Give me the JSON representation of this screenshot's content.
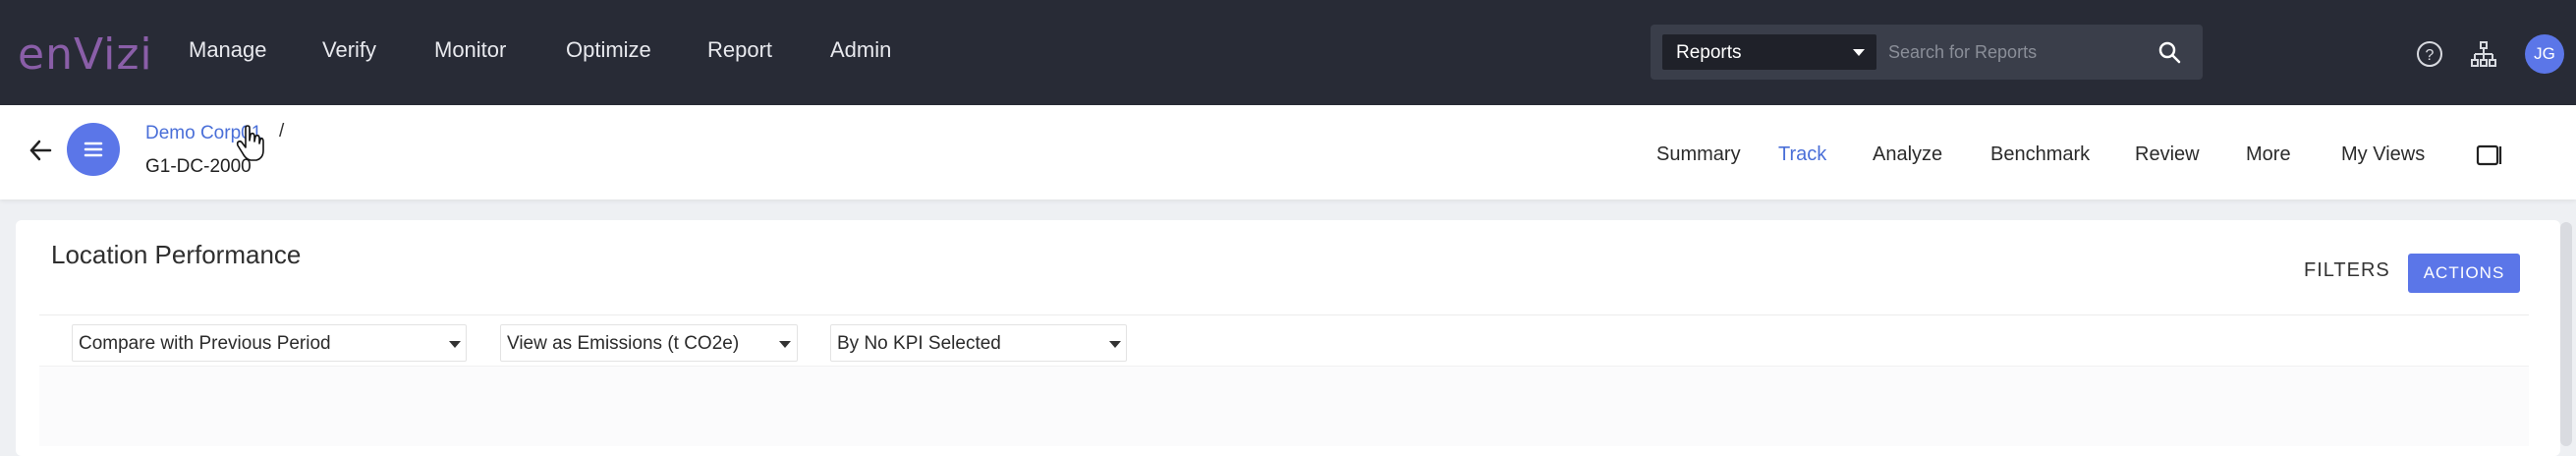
{
  "topnav": {
    "logo": "enVizi",
    "items": [
      "Manage",
      "Verify",
      "Monitor",
      "Optimize",
      "Report",
      "Admin"
    ],
    "search_scope": "Reports",
    "search_placeholder": "Search for Reports",
    "user_initials": "JG"
  },
  "breadcrumb": {
    "parent": "Demo Corp01",
    "separator": "/",
    "current": "G1-DC-2000"
  },
  "tabs": [
    "Summary",
    "Track",
    "Analyze",
    "Benchmark",
    "Review",
    "More",
    "My Views"
  ],
  "active_tab": "Track",
  "page": {
    "title": "Location Performance",
    "filters_label": "FILTERS",
    "actions_label": "ACTIONS"
  },
  "selects": {
    "compare": "Compare with Previous Period",
    "view_as": "View as Emissions (t CO2e)",
    "kpi": "By No KPI Selected"
  },
  "colors": {
    "topbar": "#282b36",
    "accent": "#5b76e8",
    "logo": "#8a5ea8",
    "link": "#4a6fd8"
  }
}
